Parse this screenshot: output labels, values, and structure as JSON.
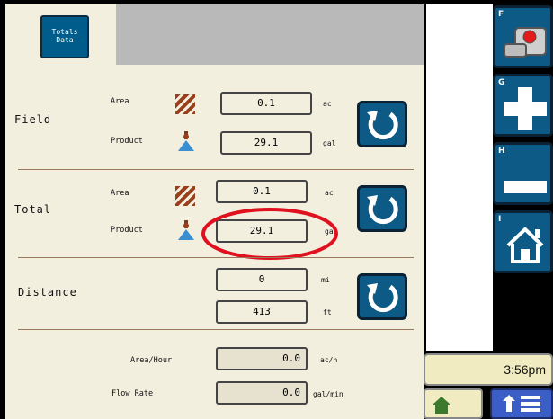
{
  "tab": {
    "line1": "Totals",
    "line2": "Data"
  },
  "field": {
    "label": "Field",
    "area_label": "Area",
    "area_value": "0.1",
    "area_unit": "ac",
    "product_label": "Product",
    "product_value": "29.1",
    "product_unit": "gal"
  },
  "total": {
    "label": "Total",
    "area_label": "Area",
    "area_value": "0.1",
    "area_unit": "ac",
    "product_label": "Product",
    "product_value": "29.1",
    "product_unit": "gal"
  },
  "distance": {
    "label": "Distance",
    "mi_value": "0",
    "mi_unit": "mi",
    "ft_value": "413",
    "ft_unit": "ft"
  },
  "area_hour": {
    "label": "Area/Hour",
    "value": "0.0",
    "unit": "ac/h"
  },
  "flow_rate": {
    "label": "Flow Rate",
    "value": "0.0",
    "unit": "gal/min"
  },
  "softkeys": {
    "f": "F",
    "g": "G",
    "h": "H",
    "i": "I"
  },
  "clock": "3:56pm",
  "colors": {
    "panel": "#f3efdf",
    "button_blue": "#0d5a86",
    "highlight_red": "#e0101e",
    "hatch": "#9a3f1b"
  }
}
